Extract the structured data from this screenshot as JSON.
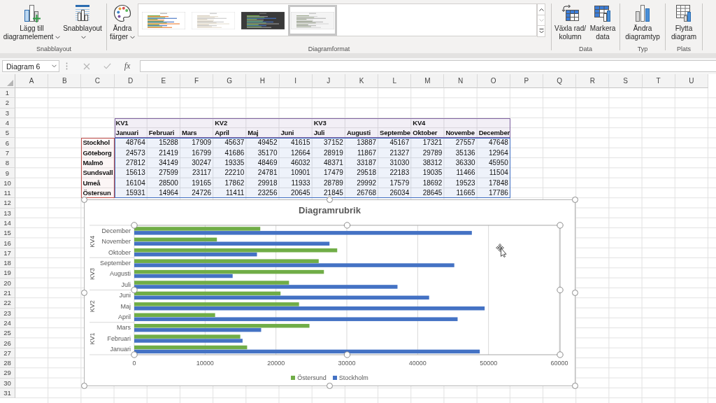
{
  "ribbon": {
    "groups": [
      {
        "label": "Snabblayout",
        "buttons": [
          {
            "kind": "add-element",
            "lines": [
              "Lägg till",
              "diagramelement"
            ],
            "dropdown": true
          },
          {
            "kind": "quick-layout",
            "lines": [
              "Snabblayout"
            ],
            "dropdown": true
          }
        ]
      },
      {
        "label": "Diagramformat",
        "buttons": [
          {
            "kind": "colors",
            "lines": [
              "Ändra",
              "färger"
            ],
            "dropdown": true
          }
        ],
        "gallery": {
          "styles": [
            {
              "kind": "green",
              "selected": false
            },
            {
              "kind": "pale",
              "selected": false
            },
            {
              "kind": "dark",
              "selected": false
            },
            {
              "kind": "gray",
              "selected": true
            }
          ],
          "scroll": [
            {
              "kind": "up",
              "disabled": false
            },
            {
              "kind": "down",
              "disabled": true
            },
            {
              "kind": "more",
              "disabled": false
            }
          ]
        }
      },
      {
        "label": "Data",
        "buttons": [
          {
            "kind": "switch",
            "lines": [
              "Växla rad/",
              "kolumn"
            ],
            "dropdown": false
          },
          {
            "kind": "select-data",
            "lines": [
              "Markera",
              "data"
            ],
            "dropdown": false
          }
        ]
      },
      {
        "label": "Typ",
        "buttons": [
          {
            "kind": "chart-type",
            "lines": [
              "Ändra",
              "diagramtyp"
            ],
            "dropdown": false
          }
        ]
      },
      {
        "label": "Plats",
        "buttons": [
          {
            "kind": "move",
            "lines": [
              "Flytta",
              "diagram"
            ],
            "dropdown": false
          }
        ]
      }
    ]
  },
  "formula_bar": {
    "name_box": "Diagram 6",
    "edit_buttons": [
      {
        "kind": "cancel",
        "disabled": true
      },
      {
        "kind": "enter",
        "disabled": true
      }
    ],
    "function_label": "fx"
  },
  "sheet": {
    "columns": [
      "A",
      "B",
      "C",
      "D",
      "E",
      "F",
      "G",
      "H",
      "I",
      "J",
      "K",
      "L",
      "M",
      "N",
      "O",
      "P",
      "Q",
      "R",
      "S",
      "T",
      "U"
    ],
    "rows": [
      "1",
      "2",
      "3",
      "4",
      "5",
      "6",
      "7",
      "8",
      "9",
      "10",
      "11",
      "12",
      "13",
      "14",
      "15",
      "16",
      "17",
      "18",
      "19",
      "20",
      "21",
      "22",
      "23",
      "24",
      "25",
      "26",
      "27",
      "28",
      "29",
      "30",
      "31"
    ],
    "table": {
      "quarters": [
        {
          "label": "KV1",
          "months": [
            "Januari",
            "Februari",
            "Mars"
          ]
        },
        {
          "label": "KV2",
          "months": [
            "April",
            "Maj",
            "Juni"
          ]
        },
        {
          "label": "KV3",
          "months": [
            "Juli",
            "Augusti",
            "Septembe"
          ]
        },
        {
          "label": "KV4",
          "months": [
            "Oktober",
            "Novembe",
            "December"
          ]
        }
      ],
      "rows": [
        {
          "name": "Stockhol",
          "values": [
            "48764",
            "15288",
            "17909",
            "45637",
            "49452",
            "41615",
            "37152",
            "13887",
            "45167",
            "17321",
            "27557",
            "47648"
          ]
        },
        {
          "name": "Göteborg",
          "values": [
            "24573",
            "21419",
            "16799",
            "41686",
            "35170",
            "12664",
            "28919",
            "11867",
            "21327",
            "29789",
            "35136",
            "12964"
          ]
        },
        {
          "name": "Malmö",
          "values": [
            "27812",
            "34149",
            "30247",
            "19335",
            "48469",
            "46032",
            "48371",
            "33187",
            "31030",
            "38312",
            "36330",
            "45950"
          ]
        },
        {
          "name": "Sundsvall",
          "values": [
            "15613",
            "27599",
            "23117",
            "22210",
            "24781",
            "10901",
            "17479",
            "29518",
            "22183",
            "19035",
            "11466",
            "11504"
          ]
        },
        {
          "name": "Umeå",
          "values": [
            "16104",
            "28500",
            "19165",
            "17862",
            "29918",
            "11933",
            "28789",
            "29992",
            "17579",
            "18692",
            "19523",
            "17848"
          ]
        },
        {
          "name": "Östersun",
          "values": [
            "15931",
            "14964",
            "24726",
            "11411",
            "23256",
            "20645",
            "21845",
            "26768",
            "26034",
            "28645",
            "11665",
            "17786"
          ]
        }
      ]
    }
  },
  "chart": {
    "selected": true,
    "plot_area_selected": true,
    "category_groups": [
      "KV4",
      "KV3",
      "KV2",
      "KV1"
    ],
    "chart_data": {
      "type": "bar",
      "orientation": "horizontal",
      "title": "Diagramrubrik",
      "categories": [
        "December",
        "November",
        "Oktober",
        "September",
        "Augusti",
        "Juli",
        "Juni",
        "Maj",
        "April",
        "Mars",
        "Februari",
        "Januari"
      ],
      "series": [
        {
          "name": "Östersund",
          "color": "#70ad47",
          "values": [
            17786,
            11665,
            28645,
            26034,
            26768,
            21845,
            20645,
            23256,
            11411,
            24726,
            14964,
            15931
          ]
        },
        {
          "name": "Stockholm",
          "color": "#4472c4",
          "values": [
            47648,
            27557,
            17321,
            45167,
            13887,
            37152,
            41615,
            49452,
            45637,
            17909,
            15288,
            48764
          ]
        }
      ],
      "xlim": [
        0,
        60000
      ],
      "xticks": [
        0,
        10000,
        20000,
        30000,
        40000,
        50000,
        60000
      ],
      "grid": true,
      "legend": "bottom"
    }
  }
}
